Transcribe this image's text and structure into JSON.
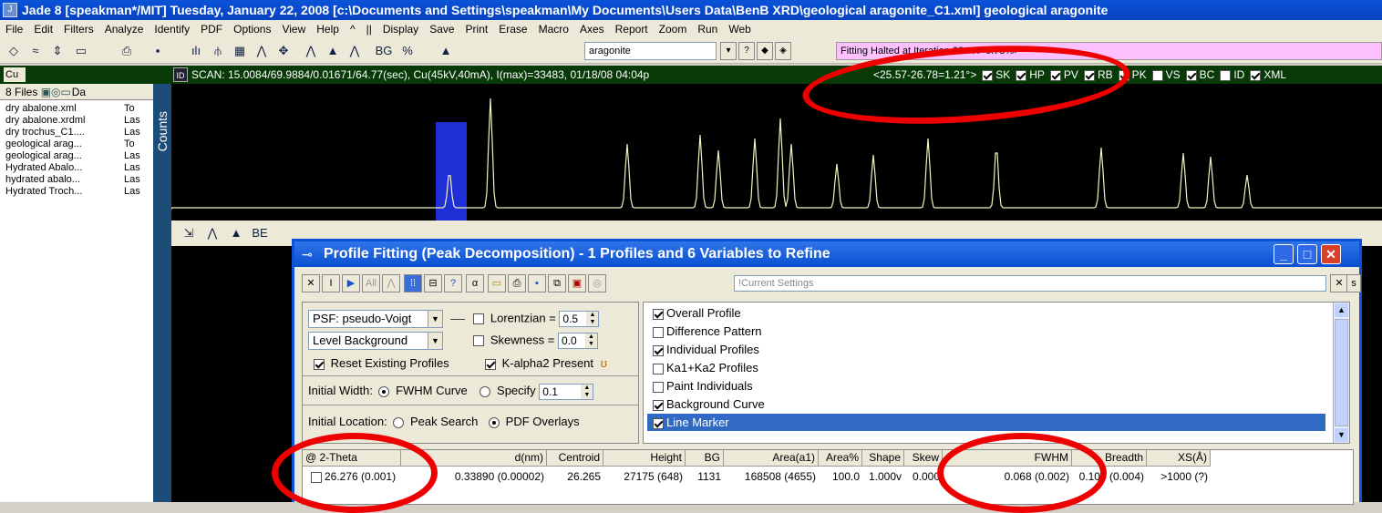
{
  "window": {
    "title": "Jade 8 [speakman*/MIT] Tuesday, January 22, 2008 [c:\\Documents and Settings\\speakman\\My Documents\\Users Data\\BenB XRD\\geological aragonite_C1.xml] geological aragonite"
  },
  "menu": [
    "File",
    "Edit",
    "Filters",
    "Analyze",
    "Identify",
    "PDF",
    "Options",
    "View",
    "Help",
    "^",
    "||",
    "Display",
    "Save",
    "Print",
    "Erase",
    "Macro",
    "Axes",
    "Report",
    "Zoom",
    "Run",
    "Web"
  ],
  "toolbar": {
    "phase_value": "aragonite",
    "status_message": "Fitting Halted at Iteration 22 <R=6.78%>"
  },
  "scan": {
    "info": "SCAN: 15.0084/69.9884/0.01671/64.77(sec), Cu(45kV,40mA), I(max)=33483, 01/18/08 04:04p",
    "range": "<25.57-26.78=1.21°>",
    "checks": [
      {
        "label": "SK",
        "on": true
      },
      {
        "label": "HP",
        "on": true
      },
      {
        "label": "PV",
        "on": true
      },
      {
        "label": "RB",
        "on": true
      },
      {
        "label": "PK",
        "on": true
      },
      {
        "label": "VS",
        "on": false
      },
      {
        "label": "BC",
        "on": true
      },
      {
        "label": "ID",
        "on": false
      },
      {
        "label": "XML",
        "on": true
      }
    ],
    "source": "Cu"
  },
  "files": {
    "header": "8 Files",
    "col": "Da",
    "items": [
      {
        "name": "dry abalone.xml",
        "st": "To"
      },
      {
        "name": "dry abalone.xrdml",
        "st": "Las"
      },
      {
        "name": "dry trochus_C1....",
        "st": "Las"
      },
      {
        "name": "geological arag...",
        "st": "To"
      },
      {
        "name": "geological arag...",
        "st": "Las"
      },
      {
        "name": "Hydrated Abalo...",
        "st": "Las"
      },
      {
        "name": "hydrated abalo...",
        "st": "Las"
      },
      {
        "name": "Hydrated Troch...",
        "st": "Las"
      }
    ]
  },
  "plot": {
    "axis_label": "Counts"
  },
  "dialog": {
    "title": "Profile Fitting (Peak Decomposition) - 1 Profiles and 6 Variables to Refine",
    "settings_placeholder": "!Current Settings",
    "psf": "PSF: pseudo-Voigt",
    "lorentzian_label": "Lorentzian =",
    "lorentzian": "0.5",
    "background": "Level Background",
    "skewness_label": "Skewness =",
    "skewness": "0.0",
    "reset_label": "Reset Existing Profiles",
    "kalpha_label": "K-alpha2 Present",
    "width_label": "Initial Width:",
    "fwhm_curve": "FWHM Curve",
    "specify": "Specify",
    "width_value": "0.1",
    "loc_label": "Initial Location:",
    "peak_search": "Peak Search",
    "pdf_overlays": "PDF Overlays",
    "display_items": [
      {
        "label": "Overall Profile",
        "on": true
      },
      {
        "label": "Difference Pattern",
        "on": false
      },
      {
        "label": "Individual Profiles",
        "on": true
      },
      {
        "label": "Ka1+Ka2 Profiles",
        "on": false
      },
      {
        "label": "Paint Individuals",
        "on": false
      },
      {
        "label": "Background Curve",
        "on": true
      },
      {
        "label": "Line Marker",
        "on": true
      }
    ],
    "columns": [
      "@ 2-Theta",
      "d(nm)",
      "Centroid",
      "Height",
      "BG",
      "Area(a1)",
      "Area%",
      "Shape",
      "Skew",
      "FWHM",
      "Breadth",
      "XS(Å)"
    ],
    "row": [
      "26.276 (0.001)",
      "0.33890 (0.00002)",
      "26.265",
      "27175 (648)",
      "1131",
      "168508 (4655)",
      "100.0",
      "1.000v",
      "0.000",
      "0.068 (0.002)",
      "0.104 (0.004)",
      ">1000 (?)"
    ]
  }
}
